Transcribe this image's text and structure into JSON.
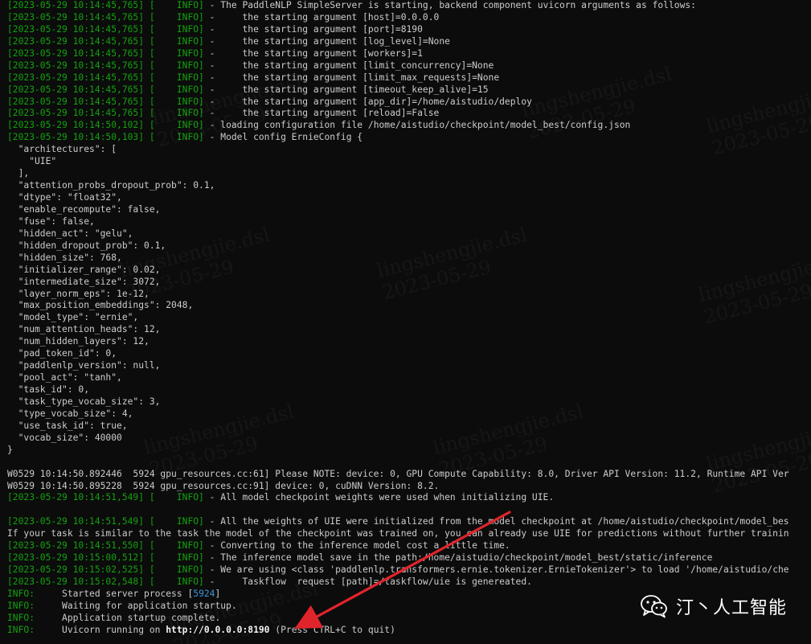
{
  "terminal": {
    "lines": [
      {
        "ts": "[2023-05-29 10:14:45,765] [    INFO]",
        "text": " - The PaddleNLP SimpleServer is starting, backend component uvicorn arguments as follows:"
      },
      {
        "ts": "[2023-05-29 10:14:45,765] [    INFO]",
        "text": " -     the starting argument [host]=0.0.0.0"
      },
      {
        "ts": "[2023-05-29 10:14:45,765] [    INFO]",
        "text": " -     the starting argument [port]=8190"
      },
      {
        "ts": "[2023-05-29 10:14:45,765] [    INFO]",
        "text": " -     the starting argument [log_level]=None"
      },
      {
        "ts": "[2023-05-29 10:14:45,765] [    INFO]",
        "text": " -     the starting argument [workers]=1"
      },
      {
        "ts": "[2023-05-29 10:14:45,765] [    INFO]",
        "text": " -     the starting argument [limit_concurrency]=None"
      },
      {
        "ts": "[2023-05-29 10:14:45,765] [    INFO]",
        "text": " -     the starting argument [limit_max_requests]=None"
      },
      {
        "ts": "[2023-05-29 10:14:45,765] [    INFO]",
        "text": " -     the starting argument [timeout_keep_alive]=15"
      },
      {
        "ts": "[2023-05-29 10:14:45,765] [    INFO]",
        "text": " -     the starting argument [app_dir]=/home/aistudio/deploy"
      },
      {
        "ts": "[2023-05-29 10:14:45,765] [    INFO]",
        "text": " -     the starting argument [reload]=False"
      },
      {
        "ts": "[2023-05-29 10:14:50,102] [    INFO]",
        "text": " - loading configuration file /home/aistudio/checkpoint/model_best/config.json"
      },
      {
        "ts": "[2023-05-29 10:14:50,103] [    INFO]",
        "text": " - Model config ErnieConfig {"
      },
      {
        "text": "  \"architectures\": ["
      },
      {
        "text": "    \"UIE\""
      },
      {
        "text": "  ],"
      },
      {
        "text": "  \"attention_probs_dropout_prob\": 0.1,"
      },
      {
        "text": "  \"dtype\": \"float32\","
      },
      {
        "text": "  \"enable_recompute\": false,"
      },
      {
        "text": "  \"fuse\": false,"
      },
      {
        "text": "  \"hidden_act\": \"gelu\","
      },
      {
        "text": "  \"hidden_dropout_prob\": 0.1,"
      },
      {
        "text": "  \"hidden_size\": 768,"
      },
      {
        "text": "  \"initializer_range\": 0.02,"
      },
      {
        "text": "  \"intermediate_size\": 3072,"
      },
      {
        "text": "  \"layer_norm_eps\": 1e-12,"
      },
      {
        "text": "  \"max_position_embeddings\": 2048,"
      },
      {
        "text": "  \"model_type\": \"ernie\","
      },
      {
        "text": "  \"num_attention_heads\": 12,"
      },
      {
        "text": "  \"num_hidden_layers\": 12,"
      },
      {
        "text": "  \"pad_token_id\": 0,"
      },
      {
        "text": "  \"paddlenlp_version\": null,"
      },
      {
        "text": "  \"pool_act\": \"tanh\","
      },
      {
        "text": "  \"task_id\": 0,"
      },
      {
        "text": "  \"task_type_vocab_size\": 3,"
      },
      {
        "text": "  \"type_vocab_size\": 4,"
      },
      {
        "text": "  \"use_task_id\": true,"
      },
      {
        "text": "  \"vocab_size\": 40000"
      },
      {
        "text": "}"
      },
      {
        "text": ""
      },
      {
        "text": "W0529 10:14:50.892446  5924 gpu_resources.cc:61] Please NOTE: device: 0, GPU Compute Capability: 8.0, Driver API Version: 11.2, Runtime API Ver"
      },
      {
        "text": "W0529 10:14:50.895228  5924 gpu_resources.cc:91] device: 0, cuDNN Version: 8.2."
      },
      {
        "ts": "[2023-05-29 10:14:51,549] [    INFO]",
        "text": " - All model checkpoint weights were used when initializing UIE."
      },
      {
        "text": ""
      },
      {
        "ts": "[2023-05-29 10:14:51,549] [    INFO]",
        "text": " - All the weights of UIE were initialized from the model checkpoint at /home/aistudio/checkpoint/model_bes"
      },
      {
        "text": "If your task is similar to the task the model of the checkpoint was trained on, you can already use UIE for predictions without further trainin"
      },
      {
        "ts": "[2023-05-29 10:14:51,550] [    INFO]",
        "text": " - Converting to the inference model cost a little time."
      },
      {
        "ts": "[2023-05-29 10:15:00,512] [    INFO]",
        "text": " - The inference model save in the path:/home/aistudio/checkpoint/model_best/static/inference"
      },
      {
        "ts": "[2023-05-29 10:15:02,525] [    INFO]",
        "text": " - We are using <class 'paddlenlp.transformers.ernie.tokenizer.ErnieTokenizer'> to load '/home/aistudio/che"
      },
      {
        "ts": "[2023-05-29 10:15:02,548] [    INFO]",
        "text": " -     Taskflow  request [path]=/taskflow/uie is genereated."
      },
      {
        "prefix": "INFO:",
        "text": "     Started server process [",
        "highlight": "5924",
        "suffix": "]"
      },
      {
        "prefix": "INFO:",
        "text": "     Waiting for application startup."
      },
      {
        "prefix": "INFO:",
        "text": "     Application startup complete."
      },
      {
        "prefix": "INFO:",
        "text": "     Uvicorn running on ",
        "bold": "http://0.0.0.0:8190",
        "suffix": " (Press CTRL+C to quit)"
      }
    ]
  },
  "watermark": {
    "lines": [
      "lingshengjie.dsl",
      "2023-05-29"
    ]
  },
  "annotation": {
    "arrow_color": "#e0242b"
  },
  "brand": {
    "icon": "wechat-icon",
    "name": "汀丶人工智能"
  }
}
